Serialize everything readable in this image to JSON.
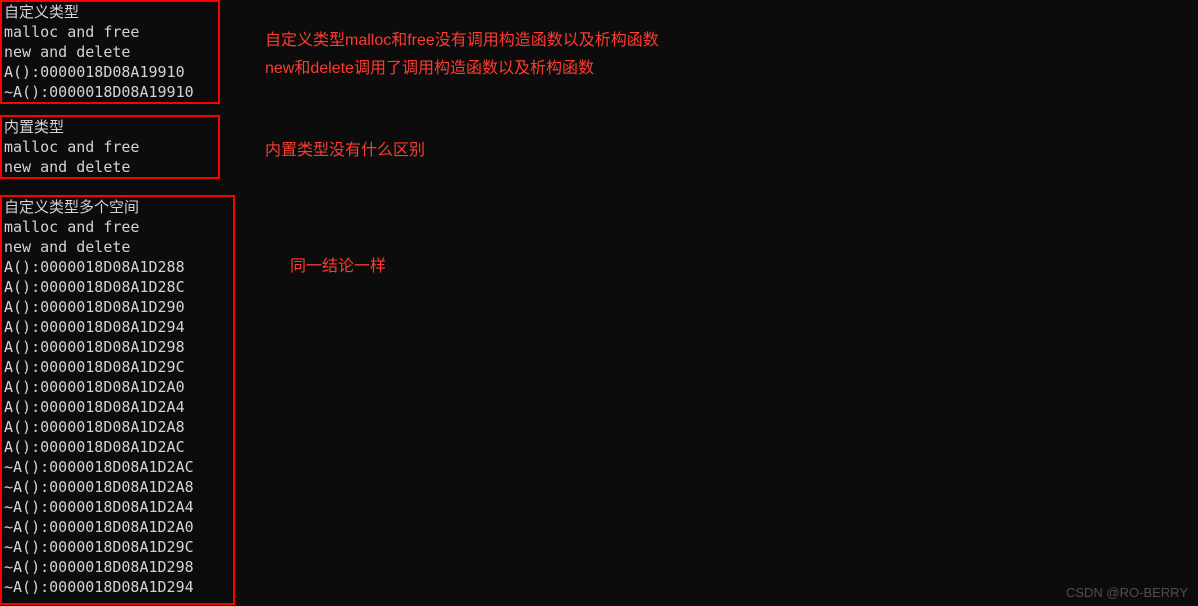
{
  "block1": {
    "lines": [
      "自定义类型",
      "malloc and free",
      "new and delete",
      "A():0000018D08A19910",
      "~A():0000018D08A19910"
    ]
  },
  "block2": {
    "lines": [
      "内置类型",
      "malloc and free",
      "new and delete"
    ]
  },
  "block3": {
    "lines": [
      "自定义类型多个空间",
      "malloc and free",
      "new and delete",
      "A():0000018D08A1D288",
      "A():0000018D08A1D28C",
      "A():0000018D08A1D290",
      "A():0000018D08A1D294",
      "A():0000018D08A1D298",
      "A():0000018D08A1D29C",
      "A():0000018D08A1D2A0",
      "A():0000018D08A1D2A4",
      "A():0000018D08A1D2A8",
      "A():0000018D08A1D2AC",
      "~A():0000018D08A1D2AC",
      "~A():0000018D08A1D2A8",
      "~A():0000018D08A1D2A4",
      "~A():0000018D08A1D2A0",
      "~A():0000018D08A1D29C",
      "~A():0000018D08A1D298",
      "~A():0000018D08A1D294"
    ]
  },
  "annotations": {
    "a1": "自定义类型malloc和free没有调用构造函数以及析构函数",
    "a2": "new和delete调用了调用构造函数以及析构函数",
    "a3": "内置类型没有什么区别",
    "a4": "同一结论一样"
  },
  "watermark": "CSDN @RO-BERRY"
}
